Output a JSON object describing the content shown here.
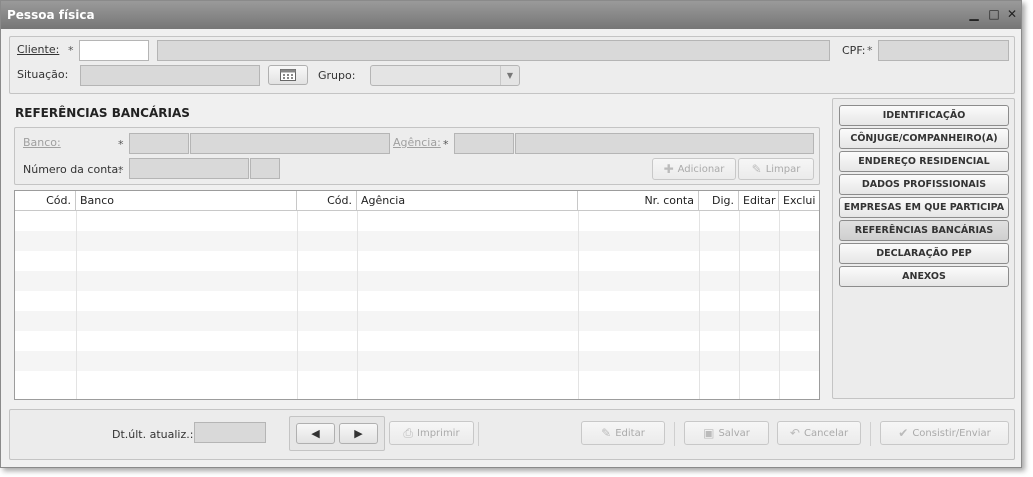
{
  "window": {
    "title": "Pessoa física",
    "minimize_icon": "minimize-icon",
    "maximize_icon": "maximize-icon",
    "close_icon": "close-icon"
  },
  "header": {
    "cliente_label": "Cliente:",
    "cpf_label": "CPF:",
    "situacao_label": "Situação:",
    "grupo_label": "Grupo:",
    "required_mark": "*",
    "cliente_code": "",
    "cliente_name": "",
    "cpf_value": "",
    "situacao_value": "",
    "grupo_value": ""
  },
  "section": {
    "title": "REFERÊNCIAS BANCÁRIAS"
  },
  "form": {
    "banco_label": "Banco:",
    "agencia_label": "Agência:",
    "numero_conta_label": "Número da conta:",
    "adicionar_label": "Adicionar",
    "limpar_label": "Limpar"
  },
  "grid": {
    "columns": [
      "Cód.",
      "Banco",
      "Cód.",
      "Agência",
      "Nr. conta",
      "Dig.",
      "Editar",
      "Exclui"
    ],
    "rows": []
  },
  "nav": {
    "items": [
      {
        "label": "IDENTIFICAÇÃO",
        "active": false
      },
      {
        "label": "CÔNJUGE/COMPANHEIRO(A)",
        "active": false
      },
      {
        "label": "ENDEREÇO RESIDENCIAL",
        "active": false
      },
      {
        "label": "DADOS PROFISSIONAIS",
        "active": false
      },
      {
        "label": "EMPRESAS EM QUE PARTICIPA",
        "active": false
      },
      {
        "label": "REFERÊNCIAS BANCÁRIAS",
        "active": true
      },
      {
        "label": "DECLARAÇÃO PEP",
        "active": false
      },
      {
        "label": "ANEXOS",
        "active": false
      }
    ]
  },
  "footer": {
    "dt_label": "Dt.últ. atualiz.:",
    "dt_value": "",
    "imprimir_label": "Imprimir",
    "editar_label": "Editar",
    "salvar_label": "Salvar",
    "cancelar_label": "Cancelar",
    "consistir_label": "Consistir/Enviar"
  },
  "colors": {
    "titlebar": "#888888",
    "panel": "#ededed",
    "active_nav": "#d6d6d6"
  }
}
